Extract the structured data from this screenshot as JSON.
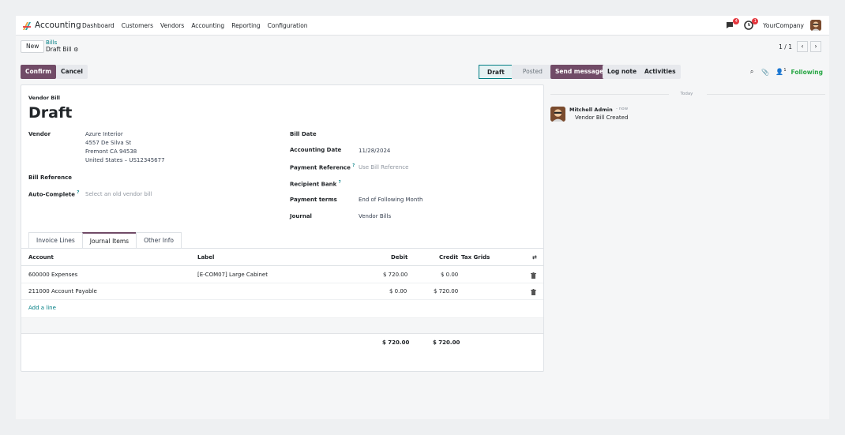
{
  "navbar": {
    "app_name": "Accounting",
    "menu": [
      "Dashboard",
      "Customers",
      "Vendors",
      "Accounting",
      "Reporting",
      "Configuration"
    ],
    "chat_badge": "4",
    "activity_badge": "1",
    "company": "YourCompany"
  },
  "control": {
    "new_label": "New",
    "breadcrumb_parent": "Bills",
    "breadcrumb_current": "Draft Bill",
    "pager": "1 / 1"
  },
  "status": {
    "confirm": "Confirm",
    "cancel": "Cancel",
    "stages": [
      "Draft",
      "Posted"
    ],
    "active_stage": "Draft"
  },
  "form": {
    "doc_type": "Vendor Bill",
    "title": "Draft",
    "vendor_label": "Vendor",
    "vendor_name": "Azure Interior",
    "vendor_addr1": "4557 De Silva St",
    "vendor_addr2": "Fremont CA 94538",
    "vendor_addr3": "United States – US12345677",
    "bill_reference_label": "Bill Reference",
    "autocomplete_label": "Auto-Complete",
    "autocomplete_placeholder": "Select an old vendor bill",
    "bill_date_label": "Bill Date",
    "accounting_date_label": "Accounting Date",
    "accounting_date": "11/28/2024",
    "payment_ref_label": "Payment Reference",
    "payment_ref_placeholder": "Use Bill Reference",
    "recipient_bank_label": "Recipient Bank",
    "payment_terms_label": "Payment terms",
    "payment_terms": "End of Following Month",
    "journal_label": "Journal",
    "journal": "Vendor Bills",
    "help_mark": "?"
  },
  "tabs": [
    "Invoice Lines",
    "Journal Items",
    "Other Info"
  ],
  "active_tab": "Journal Items",
  "table": {
    "headers": {
      "account": "Account",
      "label": "Label",
      "debit": "Debit",
      "credit": "Credit",
      "tax": "Tax Grids"
    },
    "rows": [
      {
        "account": "600000 Expenses",
        "label": "[E-COM07] Large Cabinet",
        "debit": "$ 720.00",
        "credit": "$ 0.00"
      },
      {
        "account": "211000 Account Payable",
        "label": "",
        "debit": "$ 0.00",
        "credit": "$ 720.00"
      }
    ],
    "add_line": "Add a line",
    "total_debit": "$ 720.00",
    "total_credit": "$ 720.00"
  },
  "chatter": {
    "send_message": "Send message",
    "log_note": "Log note",
    "activities": "Activities",
    "followers_count": "1",
    "following": "Following",
    "today": "Today",
    "author": "Mitchell Admin",
    "time": "- now",
    "body": "Vendor Bill Created"
  },
  "colors": {
    "brand": "#714b67",
    "teal": "#017e84",
    "green": "#28a745",
    "badge": "#e4353d"
  }
}
